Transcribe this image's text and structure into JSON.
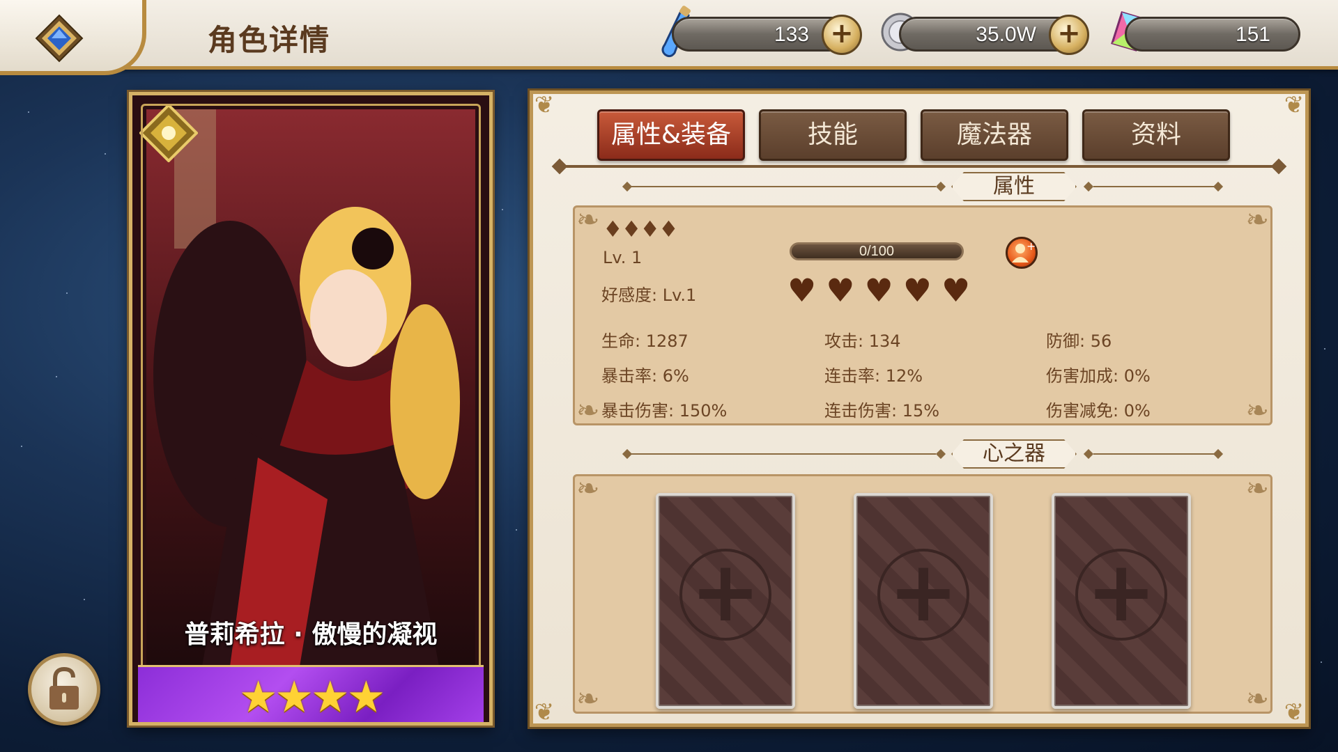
{
  "header": {
    "title": "角色详情",
    "resources": [
      {
        "name": "stamina",
        "icon": "potion-icon",
        "value": "133",
        "has_plus": true
      },
      {
        "name": "coins",
        "icon": "silver-coin-icon",
        "value": "35.0W",
        "has_plus": true
      },
      {
        "name": "crystals",
        "icon": "crystal-icon",
        "value": "151",
        "has_plus": false
      }
    ],
    "plus_glyph": "+"
  },
  "character": {
    "name": "普莉希拉 · 傲慢的凝视",
    "stars": 4,
    "star_glyphs": "★★★★"
  },
  "tabs": [
    {
      "label": "属性&装备",
      "active": true
    },
    {
      "label": "技能",
      "active": false
    },
    {
      "label": "魔法器",
      "active": false
    },
    {
      "label": "资料",
      "active": false
    }
  ],
  "attributes": {
    "section_title": "属性",
    "rank_diamonds": "♦♦♦♦",
    "level": "Lv. 1",
    "xp_text": "0/100",
    "affection": "好感度: Lv.1",
    "hearts": 5,
    "stats": [
      {
        "label": "生命: 1287"
      },
      {
        "label": "攻击: 134"
      },
      {
        "label": "防御: 56"
      },
      {
        "label": "暴击率: 6%"
      },
      {
        "label": "连击率: 12%"
      },
      {
        "label": "伤害加成: 0%"
      },
      {
        "label": "暴击伤害: 150%"
      },
      {
        "label": "连击伤害: 15%"
      },
      {
        "label": "伤害减免: 0%"
      }
    ]
  },
  "heart_vessel": {
    "section_title": "心之器",
    "slots": 3,
    "slot_glyph": "+"
  },
  "colors": {
    "active_tab": "#8b2b1a",
    "tab": "#5b3f2c",
    "panel": "#ece3d3",
    "box": "#e3c9a4",
    "star": "#ffd234",
    "card_bar": "#b34ef0"
  }
}
